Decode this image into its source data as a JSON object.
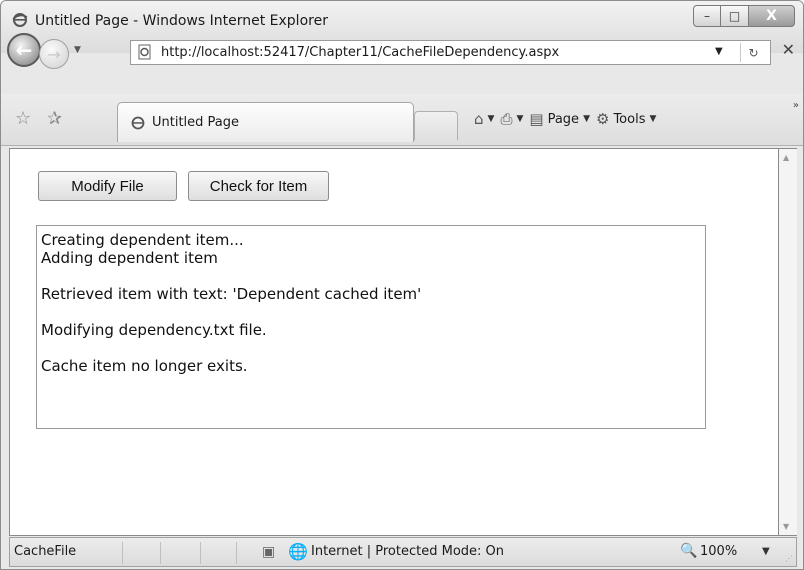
{
  "window": {
    "title": "Untitled Page - Windows Internet Explorer",
    "minimize_glyph": "–",
    "maximize_glyph": "□",
    "close_glyph": "X"
  },
  "navigation": {
    "back_glyph": "←",
    "forward_glyph": "→",
    "url": "http://localhost:52417/Chapter11/CacheFileDependency.aspx"
  },
  "tabs": [
    {
      "label": "Untitled Page"
    }
  ],
  "command_bar": {
    "page_label": "Page",
    "tools_label": "Tools"
  },
  "page": {
    "modify_button": "Modify File",
    "check_button": "Check for Item",
    "output_lines": [
      "Creating dependent item...",
      "Adding dependent item",
      "",
      "Retrieved item with text: 'Dependent cached item'",
      "",
      "Modifying dependency.txt file.",
      "",
      "Cache item no longer exits."
    ]
  },
  "status_bar": {
    "status_text": "CacheFile",
    "zone_text": "Internet | Protected Mode: On",
    "zoom": "100%"
  },
  "colors": {
    "chrome": "#e8e8e8",
    "content_bg": "#ffffff",
    "border": "#8c8c8c"
  }
}
